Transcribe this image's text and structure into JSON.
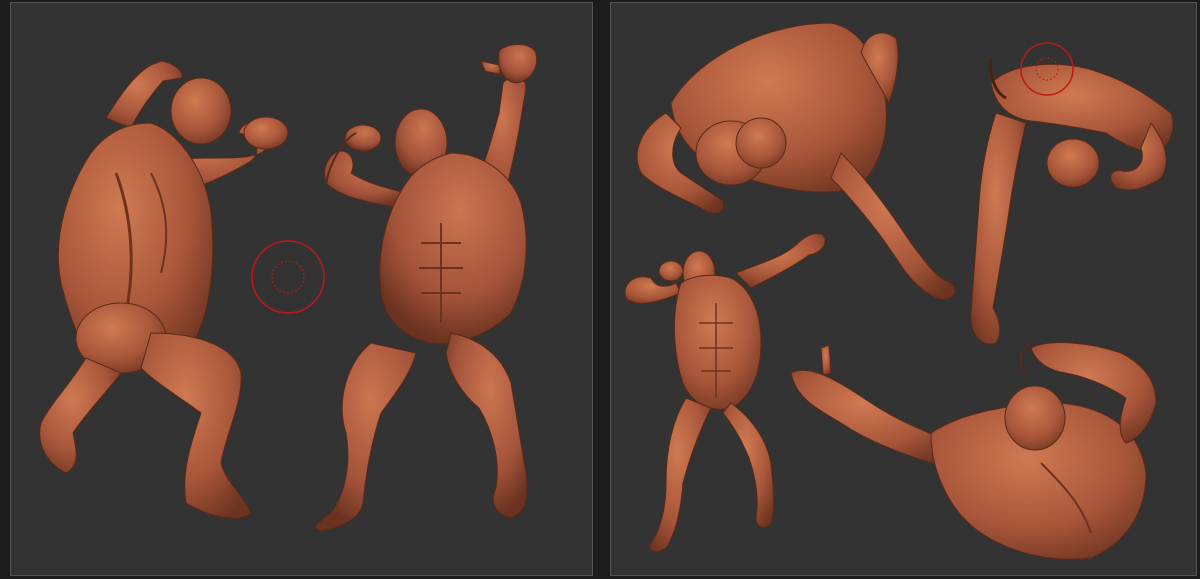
{
  "app": {
    "name": "",
    "accent_color": "#b0603e",
    "background_color": "#333333",
    "brush_cursor_color": "#c01818"
  },
  "viewports": [
    {
      "id": "left",
      "label": "",
      "contents": [
        "back-pose-figure",
        "front-pose-figure",
        "brush-cursor"
      ]
    },
    {
      "id": "right",
      "label": "",
      "contents": [
        "top-view-figure",
        "overhead-figure",
        "front-flex-figure",
        "lying-figure",
        "brush-cursor"
      ]
    }
  ]
}
